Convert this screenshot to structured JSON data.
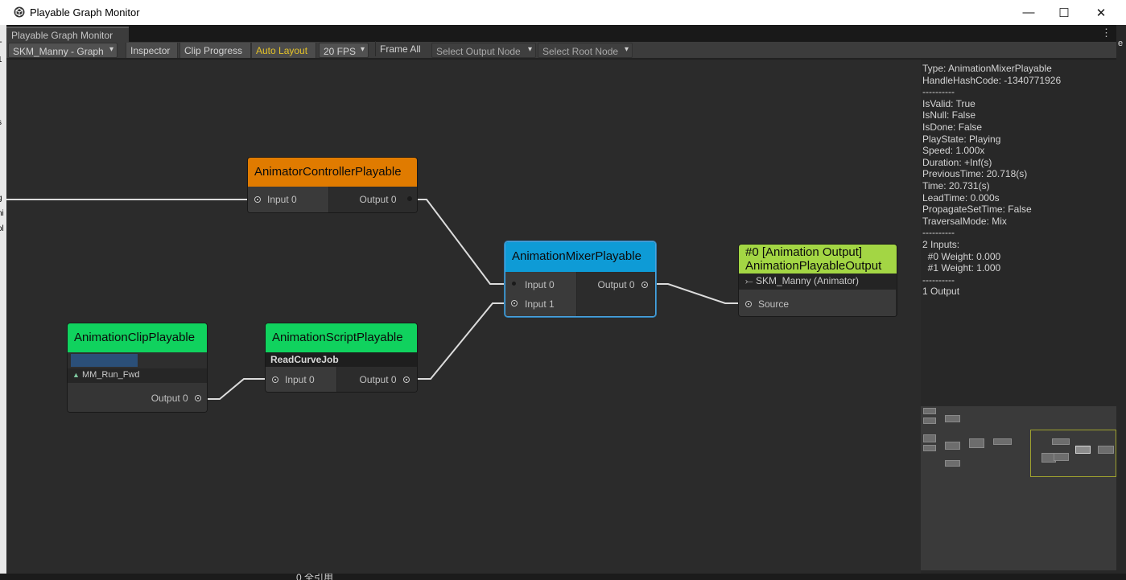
{
  "window": {
    "title": "Playable Graph Monitor",
    "controls": {
      "minimize": "—",
      "maximize": "☐",
      "close": "✕"
    }
  },
  "tab": {
    "label": "Playable Graph Monitor",
    "menu": "⋮"
  },
  "toolbar": {
    "graph_select": "SKM_Manny - Graph",
    "inspector": "Inspector",
    "clip_progress": "Clip Progress",
    "auto_layout": "Auto Layout",
    "fps": "20 FPS",
    "frame_all": "Frame All",
    "select_output": "Select Output Node",
    "select_root": "Select Root Node",
    "auto_layout_color": "#e3c128"
  },
  "nodes": {
    "controller": {
      "title": "AnimatorControllerPlayable",
      "color": "#e07b00",
      "input0": "Input 0",
      "output0": "Output 0"
    },
    "mixer": {
      "title": "AnimationMixerPlayable",
      "color": "#0e9bd6",
      "input0": "Input 0",
      "input1": "Input 1",
      "output0": "Output 0"
    },
    "output": {
      "title_line1": "#0 [Animation Output]",
      "title_line2": "AnimationPlayableOutput",
      "color": "#a3d644",
      "target": "SKM_Manny (Animator)",
      "source": "Source"
    },
    "clip": {
      "title": "AnimationClipPlayable",
      "color": "#10d25e",
      "clip_name": "MM_Run_Fwd",
      "progress": 0.5,
      "output0": "Output 0"
    },
    "script": {
      "title": "AnimationScriptPlayable",
      "color": "#10d25e",
      "job": "ReadCurveJob",
      "input0": "Input 0",
      "output0": "Output 0"
    }
  },
  "inspector": {
    "lines": [
      "Type: AnimationMixerPlayable",
      "HandleHashCode: -1340771926",
      "----------",
      "IsValid: True",
      "IsNull: False",
      "IsDone: False",
      "PlayState: Playing",
      "Speed: 1.000x",
      "Duration: +Inf(s)",
      "PreviousTime: 20.718(s)",
      "Time: 20.731(s)",
      "LeadTime: 0.000s",
      "PropagateSetTime: False",
      "TraversalMode: Mix",
      "----------",
      "2 Inputs:",
      "  #0 Weight: 0.000",
      "  #1 Weight: 1.000",
      "----------",
      "1 Output"
    ]
  },
  "background_window": {
    "left_fragments": [
      "l-",
      "1",
      "s",
      "g",
      "ni",
      "ol"
    ],
    "right_fragment": "e",
    "bottom_fragment": "0  全引用"
  }
}
